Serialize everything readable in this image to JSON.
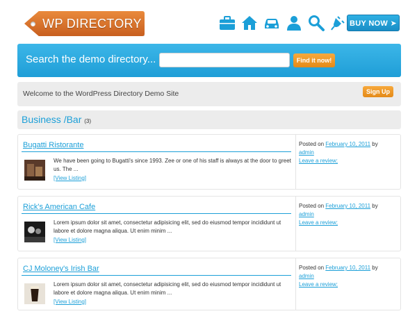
{
  "header": {
    "logo_text": "WP DIRECTORY",
    "buy_label": "BUY NOW ➤",
    "icons": [
      "briefcase-icon",
      "home-icon",
      "car-icon",
      "user-icon",
      "search-icon",
      "plug-icon"
    ]
  },
  "search": {
    "label": "Search the demo directory...",
    "value": "",
    "placeholder": "",
    "button_label": "Find it now!"
  },
  "welcome": {
    "text": "Welcome to the WordPress Directory Demo Site",
    "signup_label": "Sign Up"
  },
  "category": {
    "title": "Business /Bar",
    "count": "(3)"
  },
  "listings": [
    {
      "title": "Bugatti Ristorante",
      "description": "We have been going to Bugatti's since 1993. Zee or one of his staff is always at the door to greet us. The ...",
      "view_label": "[View Listing]",
      "posted_prefix": "Posted on",
      "date": "February 10, 2011",
      "by": "by",
      "author": "admin",
      "review_label": "Leave a review;"
    },
    {
      "title": "Rick's American Cafe",
      "description": "Lorem ipsum dolor sit amet, consectetur adipisicing elit, sed do eiusmod tempor incididunt ut labore et dolore magna aliqua. Ut enim minim ...",
      "view_label": "[View Listing]",
      "posted_prefix": "Posted on",
      "date": "February 10, 2011",
      "by": "by",
      "author": "admin",
      "review_label": "Leave a review;"
    },
    {
      "title": "CJ Moloney's Irish Bar",
      "description": "Lorem ipsum dolor sit amet, consectetur adipisicing elit, sed do eiusmod tempor incididunt ut labore et dolore magna aliqua. Ut enim minim ...",
      "view_label": "[View Listing]",
      "posted_prefix": "Posted on",
      "date": "February 10, 2011",
      "by": "by",
      "author": "admin",
      "review_label": "Leave a review;"
    }
  ],
  "colors": {
    "accent_blue": "#1b9fd8",
    "accent_orange": "#e48a18",
    "logo_orange": "#d96d27",
    "panel_gray": "#ececec"
  }
}
